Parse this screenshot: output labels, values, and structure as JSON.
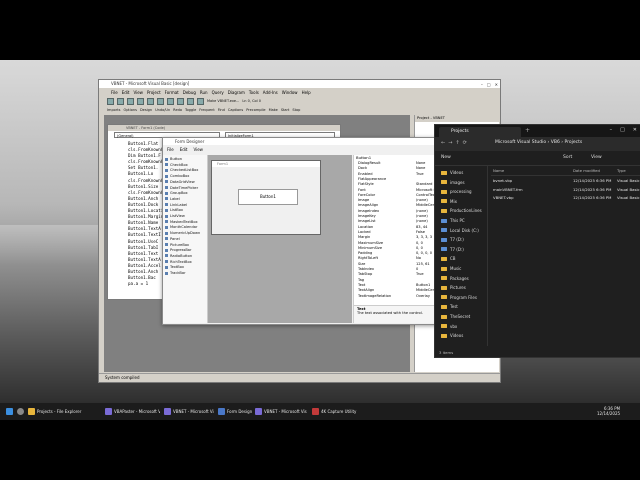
{
  "desktop": {
    "background": "#b8b8b8"
  },
  "vb": {
    "title": "VBNET - Microsoft Visual Basic [design]",
    "menu": [
      "File",
      "Edit",
      "View",
      "Project",
      "Format",
      "Debug",
      "Run",
      "Query",
      "Diagram",
      "Tools",
      "Add-Ins",
      "Window",
      "Help"
    ],
    "toolbar1": {
      "hint": "Make VBNET.exe...",
      "pos": "Ln 0, Col 0"
    },
    "toolbar2": [
      "Imports",
      "Options",
      "Design",
      "Undo/Un",
      "Redo",
      "Toggle",
      "Frequent",
      "Find",
      "Captions",
      "Precompile",
      "Make"
    ],
    "toolbar2_extra": [
      "Start",
      "Stop"
    ],
    "project_title": "Project - VBNET",
    "status": "System compiled"
  },
  "code": {
    "combo_left": "(General)",
    "combo_right": "InitializeForm1",
    "lines": [
      "Button1.Flat",
      "cls.FromKnownC",
      "Dim Button1.F",
      "cls.FromKnownC",
      "Set Button1.",
      "Button1.Lo",
      "cls.FromKnownC",
      "Button1.Size",
      "cls.FromKnownC",
      "Button1.Anch",
      "Button1.Dock",
      "Button1.Locati",
      "Button1.Margin",
      "Button1.Name",
      "Button1.TextA",
      "Button1.TextI",
      "Button1.UseC",
      "Button1.TabI",
      "Button1.Text",
      "Button1.TextA",
      "Button1.Accel",
      "Button1.Anch",
      "Button1.Bac",
      "pa.a = 1"
    ]
  },
  "designer": {
    "title": "Form Designer",
    "menu": [
      "File",
      "Edit",
      "View"
    ],
    "toolbox": [
      "Button",
      "CheckBox",
      "CheckedListBox",
      "ComboBox",
      "DataGridView",
      "DateTimePicker",
      "GroupBox",
      "Label",
      "LinkLabel",
      "ListBox",
      "ListView",
      "MaskedTextBox",
      "MonthCalendar",
      "NumericUpDown",
      "Panel",
      "PictureBox",
      "ProgressBar",
      "RadioButton",
      "RichTextBox",
      "TextBox",
      "TrackBar"
    ],
    "form_title": "Form1",
    "button_text": "Button1",
    "props_header": "Button1",
    "props": [
      [
        "DialogResult",
        "None"
      ],
      [
        "Dock",
        "None"
      ],
      [
        "Enabled",
        "True"
      ],
      [
        "FlatAppearance",
        ""
      ],
      [
        "FlatStyle",
        "Standard"
      ],
      [
        "Font",
        "Microsoft Sans"
      ],
      [
        "ForeColor",
        "ControlText"
      ],
      [
        "Image",
        "(none)"
      ],
      [
        "ImageAlign",
        "MiddleCenter"
      ],
      [
        "ImageIndex",
        "(none)"
      ],
      [
        "ImageKey",
        "(none)"
      ],
      [
        "ImageList",
        "(none)"
      ],
      [
        "Location",
        "83, 44"
      ],
      [
        "Locked",
        "False"
      ],
      [
        "Margin",
        "3, 3, 3, 3"
      ],
      [
        "MaximumSize",
        "0, 0"
      ],
      [
        "MinimumSize",
        "0, 0"
      ],
      [
        "Padding",
        "0, 0, 0, 0"
      ],
      [
        "RightToLeft",
        "No"
      ],
      [
        "Size",
        "125, 61"
      ],
      [
        "TabIndex",
        "0"
      ],
      [
        "TabStop",
        "True"
      ],
      [
        "Tag",
        ""
      ],
      [
        "Text",
        "Button1"
      ],
      [
        "TextAlign",
        "MiddleCenter"
      ],
      [
        "TextImageRelation",
        "Overlay"
      ]
    ],
    "desc_title": "Text",
    "desc_text": "The text associated with the control."
  },
  "explorer": {
    "tab": "Projects",
    "crumbs": [
      "Microsoft Visual Studio",
      "VB6",
      "Projects"
    ],
    "commands": [
      "New",
      "Sort",
      "View"
    ],
    "nav": [
      {
        "label": "Videos",
        "type": "folder"
      },
      {
        "label": "images",
        "type": "folder"
      },
      {
        "label": "processing",
        "type": "folder"
      },
      {
        "label": "Mix",
        "type": "folder"
      },
      {
        "label": "ProductionLines",
        "type": "folder"
      },
      {
        "label": "This PC",
        "type": "drive"
      },
      {
        "label": "Local Disk (C:)",
        "type": "drive"
      },
      {
        "label": "T7 (D:)",
        "type": "drive"
      },
      {
        "label": "T7 (D:)",
        "type": "drive"
      },
      {
        "label": "CB",
        "type": "folder"
      },
      {
        "label": "Music",
        "type": "folder"
      },
      {
        "label": "Packages",
        "type": "folder"
      },
      {
        "label": "Pictures",
        "type": "folder"
      },
      {
        "label": "Program Files",
        "type": "folder"
      },
      {
        "label": "Test",
        "type": "folder"
      },
      {
        "label": "TheSecret",
        "type": "folder"
      },
      {
        "label": "vbx",
        "type": "folder"
      },
      {
        "label": "Videos",
        "type": "folder"
      }
    ],
    "columns": [
      "Name",
      "Date modified",
      "Type"
    ],
    "files": [
      {
        "name": "bvnet.vbp",
        "date": "12/14/2025 6:36 PM",
        "type": "Visual Basic Pr"
      },
      {
        "name": "mainVBNET.frm",
        "date": "12/14/2025 6:36 PM",
        "type": "Visual Basic Fo"
      },
      {
        "name": "VBNET.vbp",
        "date": "12/14/2025 6:36 PM",
        "type": "Visual Basic Pr"
      }
    ],
    "status": "3 items"
  },
  "taskbar": {
    "items": [
      "Projects - File Explorer",
      "VBAPaster - Microsoft V",
      "VBNET - Microsoft Visual",
      "Form Designer",
      "VBNET - Microsoft Visu",
      "4K Capture Utility"
    ],
    "time": "6:36 PM",
    "date": "12/14/2025"
  }
}
